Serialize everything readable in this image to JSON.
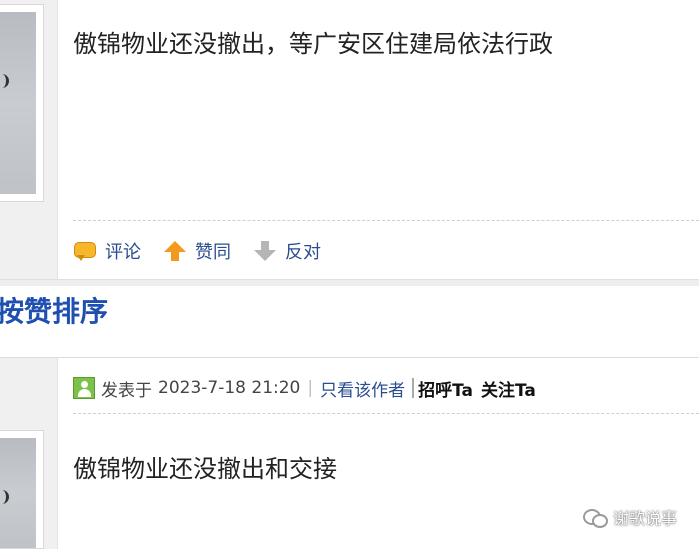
{
  "post1": {
    "content": "傲锦物业还没撤出，等广安区住建局依法行政",
    "actions": [
      {
        "icon": "comment-icon",
        "label": "评论"
      },
      {
        "icon": "arrow-up-icon",
        "label": "赞同"
      },
      {
        "icon": "arrow-down-icon",
        "label": "反对"
      }
    ]
  },
  "section": {
    "title": "按赞排序"
  },
  "post2": {
    "posted_label": "发表于",
    "date": "2023-7-18 21:20",
    "separator": "|",
    "only_author": "只看该作者",
    "greet": "招呼Ta",
    "follow": "关注Ta",
    "content": "傲锦物业还没撤出和交接"
  },
  "watermark": {
    "text": "谢歌说事"
  },
  "colors": {
    "link": "#2a4d8f",
    "section_title": "#1f4fb0",
    "arrow_up": "#f39a1e",
    "arrow_down": "#b5b5b5",
    "comment": "#f6b82a"
  }
}
